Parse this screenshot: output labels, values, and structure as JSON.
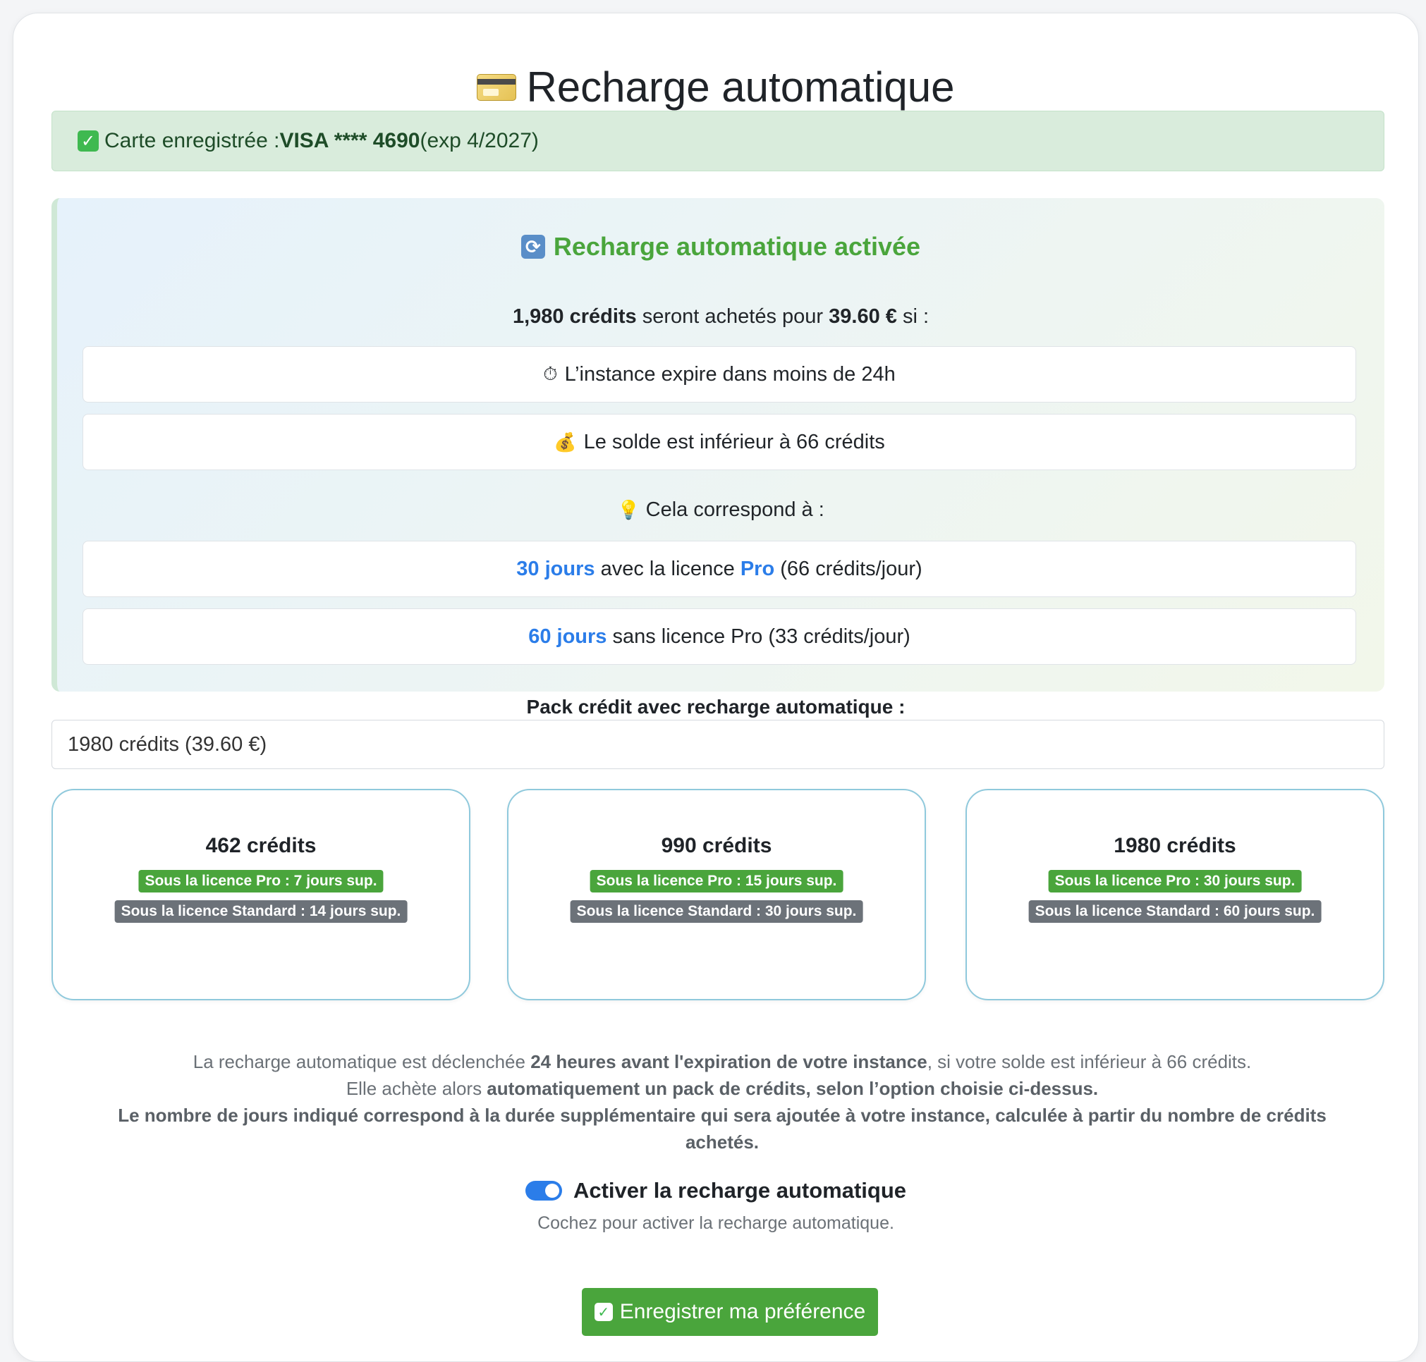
{
  "header": {
    "title": "Recharge automatique",
    "icon": "credit-card-icon"
  },
  "saved_card": {
    "prefix": "Carte enregistrée :",
    "card": "VISA **** 4690",
    "expiry": "(exp 4/2027)"
  },
  "status_panel": {
    "title": "Recharge automatique activée",
    "summary": {
      "credits": "1,980 crédits",
      "middle": " seront achetés pour ",
      "price": "39.60 €",
      "suffix": " si :"
    },
    "conditions": [
      {
        "icon": "⏱",
        "text": "L’instance expire dans moins de 24h"
      },
      {
        "icon": "💰",
        "text": "Le solde est inférieur à 66 crédits"
      }
    ],
    "equivalence_label": "Cela correspond à :",
    "equivalence_icon": "💡",
    "equivalences": [
      {
        "days": "30 jours",
        "pre": " avec la licence ",
        "pro": "Pro",
        "post": " (66 crédits/jour)"
      },
      {
        "days": "60 jours",
        "pre": " sans licence Pro (33 crédits/jour)",
        "pro": "",
        "post": ""
      }
    ]
  },
  "pack": {
    "label": "Pack crédit avec recharge automatique :",
    "selected": "1980 crédits (39.60 €)"
  },
  "pack_cards": [
    {
      "title": "462 crédits",
      "pro": "Sous la licence Pro : 7 jours sup.",
      "standard": "Sous la licence Standard : 14 jours sup."
    },
    {
      "title": "990 crédits",
      "pro": "Sous la licence Pro : 15 jours sup.",
      "standard": "Sous la licence Standard : 30 jours sup."
    },
    {
      "title": "1980 crédits",
      "pro": "Sous la licence Pro : 30 jours sup.",
      "standard": "Sous la licence Standard : 60 jours sup."
    }
  ],
  "note": {
    "l1a": "La recharge automatique est déclenchée ",
    "l1b": "24 heures avant l'expiration de votre instance",
    "l1c": ", si votre solde est inférieur à 66 crédits.",
    "l2a": "Elle achète alors ",
    "l2b": "automatiquement un pack de crédits, selon l’option choisie ci-dessus.",
    "l3": "Le nombre de jours indiqué correspond à la durée supplémentaire qui sera ajoutée à votre instance, calculée à partir du nombre de crédits achetés."
  },
  "toggle": {
    "label": "Activer la recharge automatique",
    "help": "Cochez pour activer la recharge automatique.",
    "checked": true
  },
  "save_button": {
    "label": "Enregistrer ma préférence"
  },
  "colors": {
    "accent_green": "#4aa53c",
    "accent_blue": "#2b7de9",
    "alert_bg": "#d9ecdc",
    "badge_gray": "#6c7279"
  }
}
